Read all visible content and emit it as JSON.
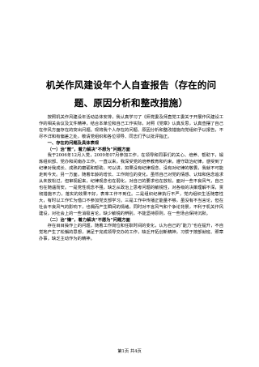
{
  "document": {
    "title": "机关作风建设年个人自查报告（存在的问题、原因分析和整改措施）",
    "paragraphs": [
      {
        "type": "body",
        "text": "按照机关作风建设年活动总体安排，我认真学习了《师党委及师直党工委关于开展作风建设工作的相关会议及文件精神，结合本单位和自己工作实际，对照《党章》认真反思，认真查摆了自己在作风方面存在的突出问题。现将我个人存在的问题、原因分析和整改措施向党组织予以报告，不尽不详和有偏差之处，敬请党组织和各位领导、同志们予以批评指正。"
      },
      {
        "type": "heading",
        "text": "一、存在的问题及具体表现"
      },
      {
        "type": "heading",
        "text": "（一）治“散”，着力解决“不想为”问题方面"
      },
      {
        "type": "body",
        "text": "我于2006年12月入党，2009年07月参加工作，在领导和同事们的关心、培养、帮助下，锻炼组织部、党办和间南办工作。一直以来，我深受党的培养教育和约束，遵守政治纪律，感受到了纪律对我成长、成熟的磨砺和帮助，可以讲，如果没有纪律观念、没有对纪律的敬畏，我就不可能走到今天。另一方面，随着年龄的增长、工作岗位的变化，虽然自己对党的情感、认知和信念追求从未放松过，但审视起来，纪律观念也在弱化，对自己的要求也在放松，面对一些不良风气，自己也在随遇而安。一是党性观念不强，缺乏从政治上思考问题的敏锐性，对各级的决策理解不深，贯彻措施不力，落实的效果不好，表率工作不到位。二是组织纪律执行不严，党内组织生活随意性大，有时以工作忙为借口不参加党支部学习。三是工作中传播正能量不够，虽没有不当言论，但在社会不良风气的影响下，也偶而产生瞬间的情绪，同时对不言风气和个争论背景，不利于机关作风建设，对社会上的一些消极言论，缺少敏锐的辨别，不能坚持原则，在一些场合保持沉默。"
      },
      {
        "type": "heading",
        "text": "（二）治“懒”，着力解决“不愿为”问题方面"
      },
      {
        "type": "body",
        "text": "存在目目操作上的问题，随着工作岗位和任职时间的变化，认为自己的“能力”也在提升，不自觉地产生了松懈的思想，满足于完成领导交办的工作，缺乏开拓创新精神，习惯于按部就班、照章办事，缺乏主动作为的精神。"
      }
    ],
    "footer": "第1页 共4页"
  }
}
